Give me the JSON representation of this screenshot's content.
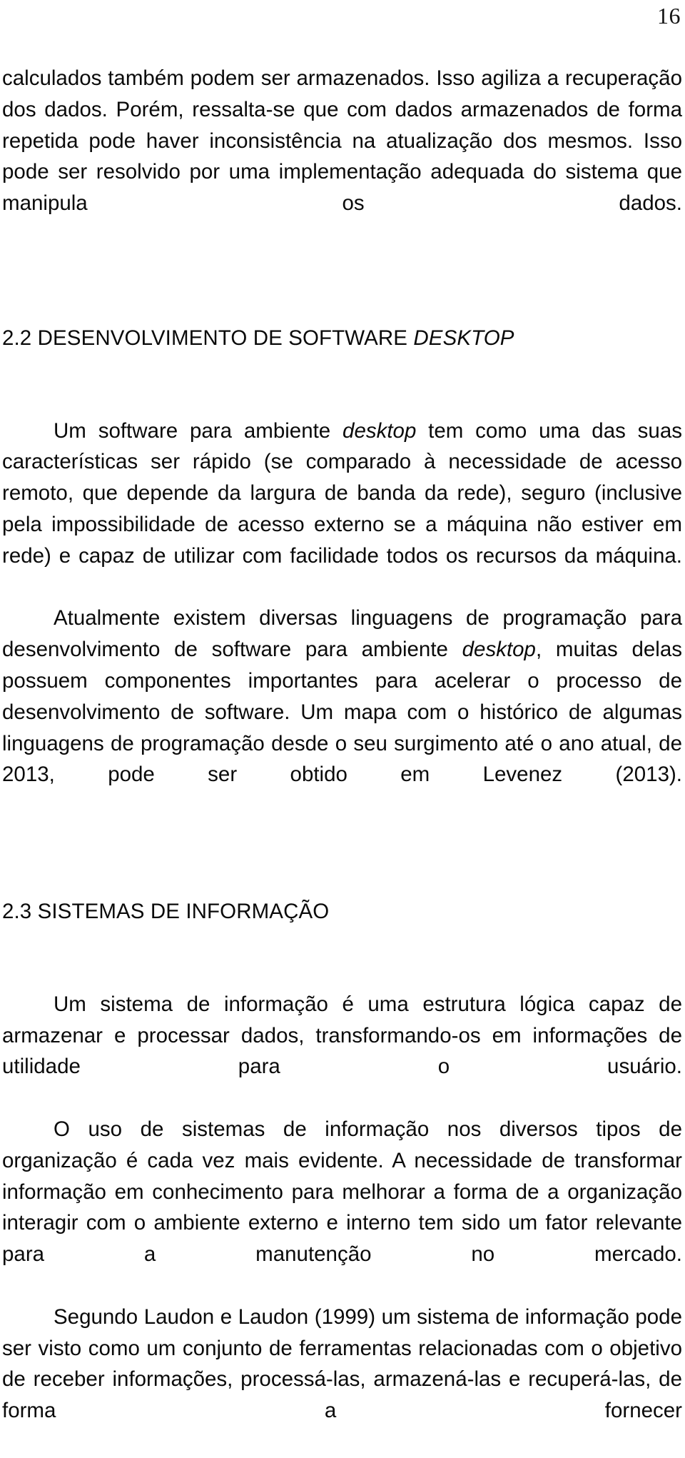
{
  "document": {
    "language": "pt-BR",
    "page_number": "16",
    "colors": {
      "text": "#0a0a0a",
      "page_background": "#ffffff",
      "page_number": "#141414"
    }
  },
  "content": {
    "paragraph_1": {
      "text": "calculados também podem ser armazenados. Isso agiliza a recuperação dos dados. Porém, ressalta-se que com dados armazenados de forma repetida pode haver inconsistência na atualização dos mesmos. Isso pode ser resolvido por uma implementação adequada do sistema que manipula os dados."
    },
    "heading_2_2": {
      "number": "2.2",
      "text_roman": "DESENVOLVIMENTO DE SOFTWARE",
      "text_italic": "DESKTOP",
      "full": "2.2 DESENVOLVIMENTO DE SOFTWARE DESKTOP"
    },
    "paragraph_2": {
      "part_1": "Um software para ambiente ",
      "italic_1": "desktop",
      "part_2": " tem como uma das suas características ser rápido (se comparado à necessidade de acesso remoto, que depende da largura de banda da rede), seguro (inclusive pela impossibilidade de acesso externo se a máquina não estiver em rede) e capaz de utilizar com facilidade todos os recursos da máquina."
    },
    "paragraph_3": {
      "part_1": "Atualmente existem diversas linguagens de programação para desenvolvimento de software para ambiente ",
      "italic_1": "desktop",
      "part_2": ", muitas delas possuem componentes importantes para acelerar o processo de desenvolvimento de software. Um mapa com o histórico de algumas linguagens de programação desde o seu surgimento até o ano atual, de 2013, pode ser obtido em Levenez (2013)."
    },
    "heading_2_3": {
      "number": "2.3",
      "text_roman": "SISTEMAS DE INFORMAÇÃO",
      "full": "2.3 SISTEMAS DE INFORMAÇÃO"
    },
    "paragraph_4": {
      "text": "Um sistema de informação é uma estrutura lógica capaz de armazenar e processar dados, transformando-os em informações de utilidade para o usuário."
    },
    "paragraph_5": {
      "text": "O uso de sistemas de informação nos diversos tipos de organização é cada vez mais evidente. A necessidade de transformar informação em conhecimento para melhorar a forma de a organização interagir com o ambiente externo e interno tem sido um fator relevante para a manutenção no mercado."
    },
    "paragraph_6": {
      "text": "Segundo Laudon e Laudon (1999) um sistema de informação pode ser visto como um conjunto de ferramentas relacionadas com o objetivo de receber informações, processá-las, armazená-las e recuperá-las, de forma a fornecer"
    }
  }
}
